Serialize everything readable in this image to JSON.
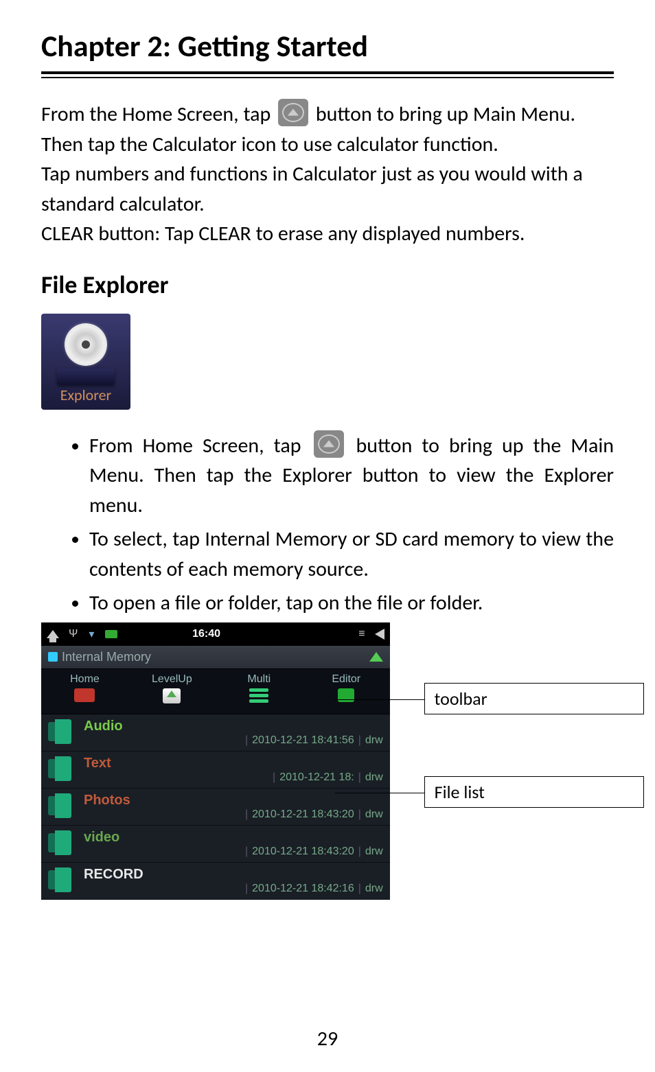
{
  "chapter_title": "Chapter 2: Getting Started",
  "para1_a": "From the Home Screen, tap",
  "para1_b": "button to bring up Main Menu. Then tap the Calculator icon to use calculator function.",
  "para2": "Tap numbers and functions in Calculator just as you would with a standard calculator.",
  "para3": "CLEAR button: Tap CLEAR to erase any displayed numbers.",
  "section_heading": "File Explorer",
  "explorer_icon_label": "Explorer",
  "bullet1_a": "From Home Screen, tap",
  "bullet1_b": "button to bring up the Main Menu.   Then tap the Explorer button to view the Explorer menu.",
  "bullet2": "To select, tap Internal Memory or SD card memory to view the contents of each memory source.",
  "bullet3": "To open a file or folder, tap on the file or folder.",
  "screenshot": {
    "status_clock": "16:40",
    "title": "Internal Memory",
    "toolbar": {
      "home": "Home",
      "levelup": "LevelUp",
      "multi": "Multi",
      "editor": "Editor"
    },
    "files": [
      {
        "name": "Audio",
        "date": "2010-12-21 18:41:56",
        "attr": "drw",
        "color_class": "name-audio"
      },
      {
        "name": "Text",
        "date": "2010-12-21 18:",
        "attr": "drw",
        "color_class": "name-text",
        "truncated": true
      },
      {
        "name": "Photos",
        "date": "2010-12-21 18:43:20",
        "attr": "drw",
        "color_class": "name-photos"
      },
      {
        "name": "video",
        "date": "2010-12-21 18:43:20",
        "attr": "drw",
        "color_class": "name-video"
      },
      {
        "name": "RECORD",
        "date": "2010-12-21 18:42:16",
        "attr": "drw",
        "color_class": "name-record"
      }
    ]
  },
  "callouts": {
    "toolbar": "toolbar",
    "filelist": "File list"
  },
  "page_number": "29"
}
